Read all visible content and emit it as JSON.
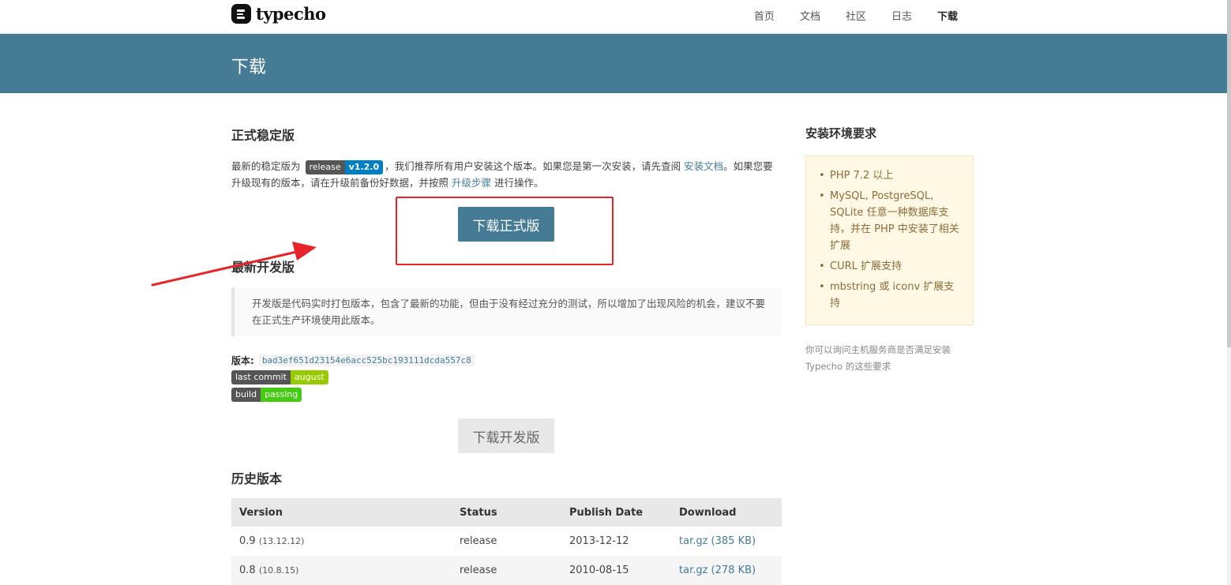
{
  "header": {
    "logo_text": "typecho",
    "nav": [
      {
        "label": "首页",
        "active": false
      },
      {
        "label": "文档",
        "active": false
      },
      {
        "label": "社区",
        "active": false
      },
      {
        "label": "日志",
        "active": false
      },
      {
        "label": "下载",
        "active": true
      }
    ]
  },
  "banner": {
    "title": "下载"
  },
  "stable": {
    "title": "正式稳定版",
    "text_before_badge": "最新的稳定版为",
    "badge_left": "release",
    "badge_right": "v1.2.0",
    "text_after_badge": "，我们推荐所有用户安装这个版本。如果您是第一次安装，请先查阅",
    "install_doc_link": "安装文档",
    "text_line2_a": "。如果您要升级现有的版本，请在升级前备份好数据，并按照",
    "upgrade_link": "升级步骤",
    "text_line2_b": "进行操作。",
    "download_button": "下载正式版"
  },
  "dev": {
    "title": "最新开发版",
    "quote": "开发版是代码实时打包版本，包含了最新的功能，但由于没有经过充分的测试，所以增加了出现风险的机会，建议不要在正式生产环境使用此版本。",
    "version_label": "版本:",
    "version_hash": "bad3ef651d23154e6acc525bc193111dcda557c8",
    "commit_badge_left": "last commit",
    "commit_badge_right": "august",
    "build_badge_left": "build",
    "build_badge_right": "passing",
    "download_button": "下载开发版"
  },
  "history": {
    "title": "历史版本",
    "columns": [
      "Version",
      "Status",
      "Publish Date",
      "Download"
    ],
    "rows": [
      {
        "version": "0.9",
        "build": "(13.12.12)",
        "status": "release",
        "date": "2013-12-12",
        "download": "tar.gz (385 KB)"
      },
      {
        "version": "0.8",
        "build": "(10.8.15)",
        "status": "release",
        "date": "2010-08-15",
        "download": "tar.gz (278 KB)"
      }
    ]
  },
  "sidebar": {
    "title": "安装环境要求",
    "requirements": [
      "PHP 7.2 以上",
      "MySQL, PostgreSQL, SQLite 任意一种数据库支持，并在 PHP 中安装了相关扩展",
      "CURL 扩展支持",
      "mbstring 或 iconv 扩展支持"
    ],
    "note": "你可以询问主机服务商是否满足安装 Typecho 的这些要求"
  },
  "colors": {
    "accent": "#467b96",
    "annotation_red": "#e8242b"
  }
}
